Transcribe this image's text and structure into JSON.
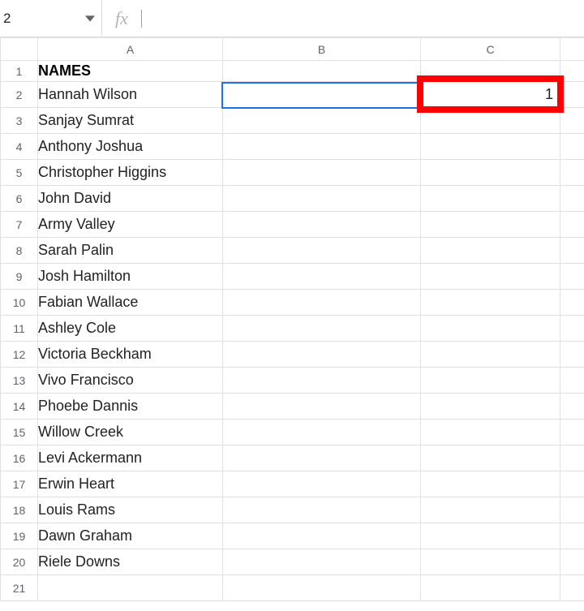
{
  "top": {
    "name_box": "2",
    "fx_label": "fx",
    "formula_value": ""
  },
  "columns": [
    "A",
    "B",
    "C"
  ],
  "rows": {
    "count": 21,
    "labels": [
      "1",
      "2",
      "3",
      "4",
      "5",
      "6",
      "7",
      "8",
      "9",
      "10",
      "11",
      "12",
      "13",
      "14",
      "15",
      "16",
      "17",
      "18",
      "19",
      "20",
      "21"
    ]
  },
  "cells": {
    "A1": "NAMES",
    "A2": "Hannah Wilson",
    "A3": "Sanjay Sumrat",
    "A4": "Anthony Joshua",
    "A5": "Christopher Higgins",
    "A6": "John David",
    "A7": "Army Valley",
    "A8": "Sarah Palin",
    "A9": "Josh Hamilton",
    "A10": "Fabian Wallace",
    "A11": "Ashley Cole",
    "A12": "Victoria Beckham",
    "A13": "Vivo Francisco",
    "A14": "Phoebe Dannis",
    "A15": "Willow Creek",
    "A16": "Levi Ackermann",
    "A17": "Erwin Heart",
    "A18": "Louis Rams",
    "A19": "Dawn Graham",
    "A20": "Riele Downs",
    "C2": "1"
  },
  "selection": {
    "cell": "B2"
  },
  "highlight": {
    "cell": "C2"
  }
}
